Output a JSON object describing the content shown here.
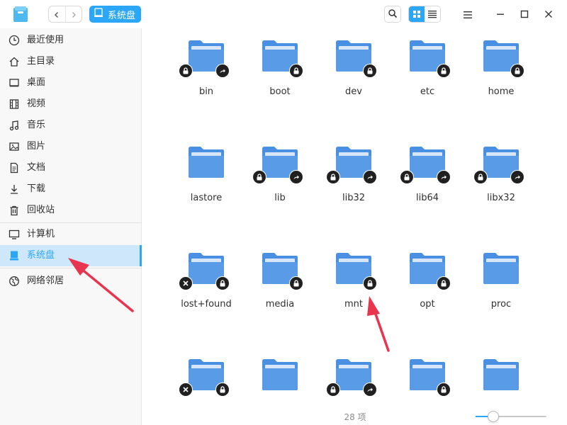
{
  "titlebar": {
    "app_icon": "file-manager-icon",
    "back_icon": "chevron-left-icon",
    "forward_icon": "chevron-right-icon",
    "breadcrumb_label": "系统盘",
    "breadcrumb_icon": "disk-icon",
    "search_icon": "search-icon",
    "icon_view_icon": "grid-view-icon",
    "list_view_icon": "list-view-icon",
    "menu_icon": "hamburger-menu-icon",
    "minimize_icon": "minimize-icon",
    "maximize_icon": "maximize-icon",
    "close_icon": "close-icon",
    "active_view": "icon"
  },
  "sidebar": {
    "groups": [
      [
        {
          "label": "最近使用",
          "icon": "clock-icon"
        },
        {
          "label": "主目录",
          "icon": "home-icon"
        },
        {
          "label": "桌面",
          "icon": "desktop-icon"
        },
        {
          "label": "视频",
          "icon": "film-icon"
        },
        {
          "label": "音乐",
          "icon": "music-icon"
        },
        {
          "label": "图片",
          "icon": "image-icon"
        },
        {
          "label": "文档",
          "icon": "document-icon"
        },
        {
          "label": "下载",
          "icon": "download-icon"
        },
        {
          "label": "回收站",
          "icon": "trash-icon"
        }
      ],
      [
        {
          "label": "计算机",
          "icon": "computer-icon"
        },
        {
          "label": "系统盘",
          "icon": "disk-icon",
          "selected": true
        }
      ],
      [
        {
          "label": "网络邻居",
          "icon": "network-icon"
        }
      ]
    ]
  },
  "files": [
    {
      "name": "bin",
      "emblems": [
        "lock",
        "link"
      ]
    },
    {
      "name": "boot",
      "emblems": [
        "",
        "lock"
      ]
    },
    {
      "name": "dev",
      "emblems": [
        "",
        "lock"
      ]
    },
    {
      "name": "etc",
      "emblems": [
        "",
        "lock"
      ]
    },
    {
      "name": "home",
      "emblems": [
        "",
        "lock"
      ]
    },
    {
      "name": "lastore",
      "emblems": [
        "",
        ""
      ]
    },
    {
      "name": "lib",
      "emblems": [
        "lock",
        "link"
      ]
    },
    {
      "name": "lib32",
      "emblems": [
        "lock",
        "link"
      ]
    },
    {
      "name": "lib64",
      "emblems": [
        "lock",
        "link"
      ]
    },
    {
      "name": "libx32",
      "emblems": [
        "lock",
        "link"
      ]
    },
    {
      "name": "lost+found",
      "emblems": [
        "cross",
        "lock"
      ]
    },
    {
      "name": "media",
      "emblems": [
        "",
        "lock"
      ]
    },
    {
      "name": "mnt",
      "emblems": [
        "",
        "lock"
      ]
    },
    {
      "name": "opt",
      "emblems": [
        "",
        "lock"
      ]
    },
    {
      "name": "proc",
      "emblems": [
        "",
        ""
      ]
    },
    {
      "name": "",
      "emblems": [
        "cross",
        "lock"
      ]
    },
    {
      "name": "",
      "emblems": [
        "",
        ""
      ]
    },
    {
      "name": "",
      "emblems": [
        "lock",
        "link"
      ]
    },
    {
      "name": "",
      "emblems": [
        "",
        "lock"
      ]
    },
    {
      "name": "",
      "emblems": [
        "",
        ""
      ]
    }
  ],
  "status": {
    "item_count": "28 项",
    "zoom_level": 0.25
  },
  "colors": {
    "accent": "#2ca7f8",
    "folder": "#4a90e2",
    "annotation_arrow": "#e8344e"
  }
}
